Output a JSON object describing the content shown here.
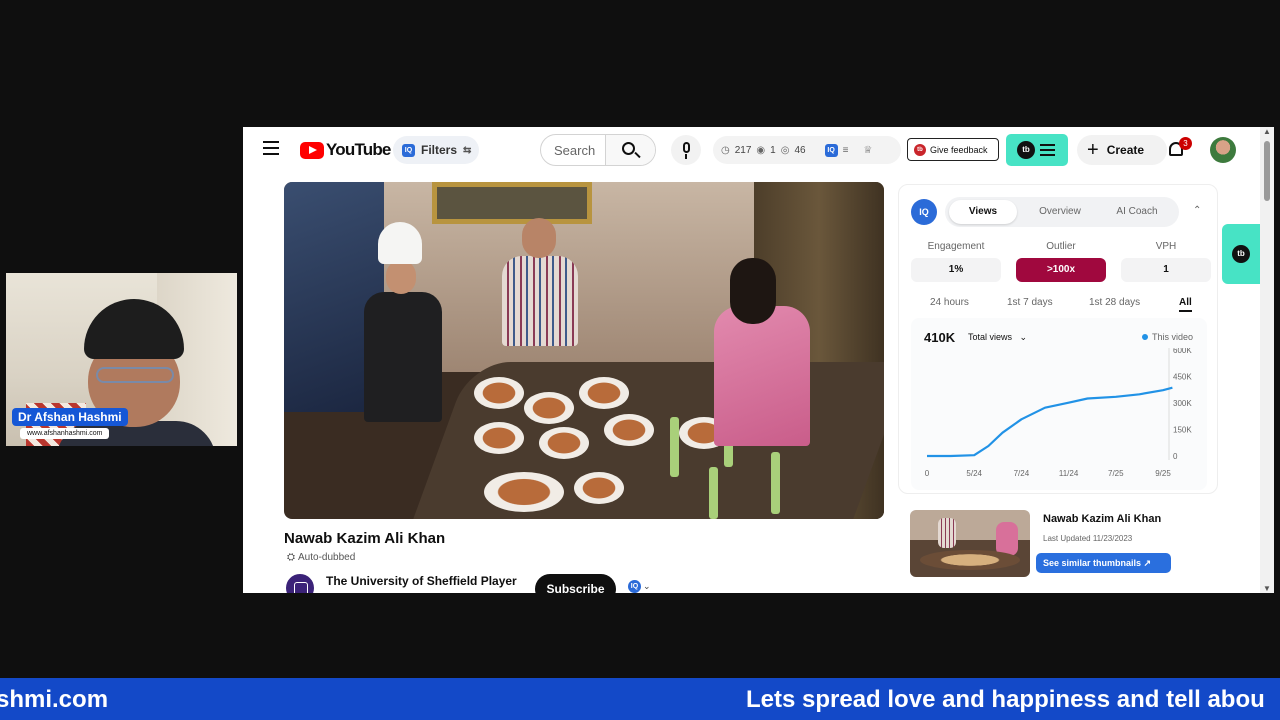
{
  "webcam": {
    "name": "Dr Afshan Hashmi",
    "website": "www.afshanhashmi.com"
  },
  "header": {
    "logo_text": "YouTube",
    "filters_label": "Filters",
    "search_placeholder": "Search",
    "stats": {
      "clock": "217",
      "live": "1",
      "views": "46"
    },
    "feedback_label": "Give feedback",
    "create_label": "Create",
    "notification_count": "3",
    "brand_color": "#ff0000",
    "accent_color": "#47e3c5"
  },
  "video": {
    "title": "Nawab Kazim Ali Khan",
    "auto_dubbed": "Auto-dubbed",
    "channel": "The University of Sheffield Player",
    "subscribe_label": "Subscribe"
  },
  "panel": {
    "tabs": [
      "Views",
      "Overview",
      "AI Coach"
    ],
    "active_tab": "Views",
    "metrics": [
      {
        "label": "Engagement",
        "value": "1%"
      },
      {
        "label": "Outlier",
        "value": ">100x"
      },
      {
        "label": "VPH",
        "value": "1"
      }
    ],
    "ranges": [
      "24 hours",
      "1st 7 days",
      "1st 28 days",
      "All"
    ],
    "active_range": "All",
    "total": "410K",
    "metric_select": "Total views",
    "legend": "This video"
  },
  "chart_data": {
    "type": "line",
    "x_tick_labels": [
      "0",
      "5/24",
      "7/24",
      "11/24",
      "7/25",
      "9/25"
    ],
    "y_tick_labels": [
      "600K",
      "450K",
      "300K",
      "150K",
      "0"
    ],
    "ylim": [
      0,
      600000
    ],
    "series": [
      {
        "name": "This video",
        "color": "#2192e6",
        "points": [
          [
            0,
            0
          ],
          [
            0.5,
            0
          ],
          [
            1,
            5000
          ],
          [
            1.3,
            60000
          ],
          [
            1.6,
            140000
          ],
          [
            2,
            220000
          ],
          [
            2.5,
            290000
          ],
          [
            3,
            320000
          ],
          [
            3.4,
            345000
          ],
          [
            4,
            355000
          ],
          [
            4.5,
            370000
          ],
          [
            5,
            395000
          ],
          [
            5.2,
            410000
          ]
        ]
      }
    ],
    "grid": false,
    "legend_position": "top-right"
  },
  "similar": {
    "title": "Nawab Kazim Ali Khan",
    "updated": "Last Updated 11/23/2023",
    "button_label": "See similar thumbnails ↗"
  },
  "ticker": {
    "left_text": "shmi.com",
    "right_text": "Lets spread love and happiness and tell abou"
  }
}
